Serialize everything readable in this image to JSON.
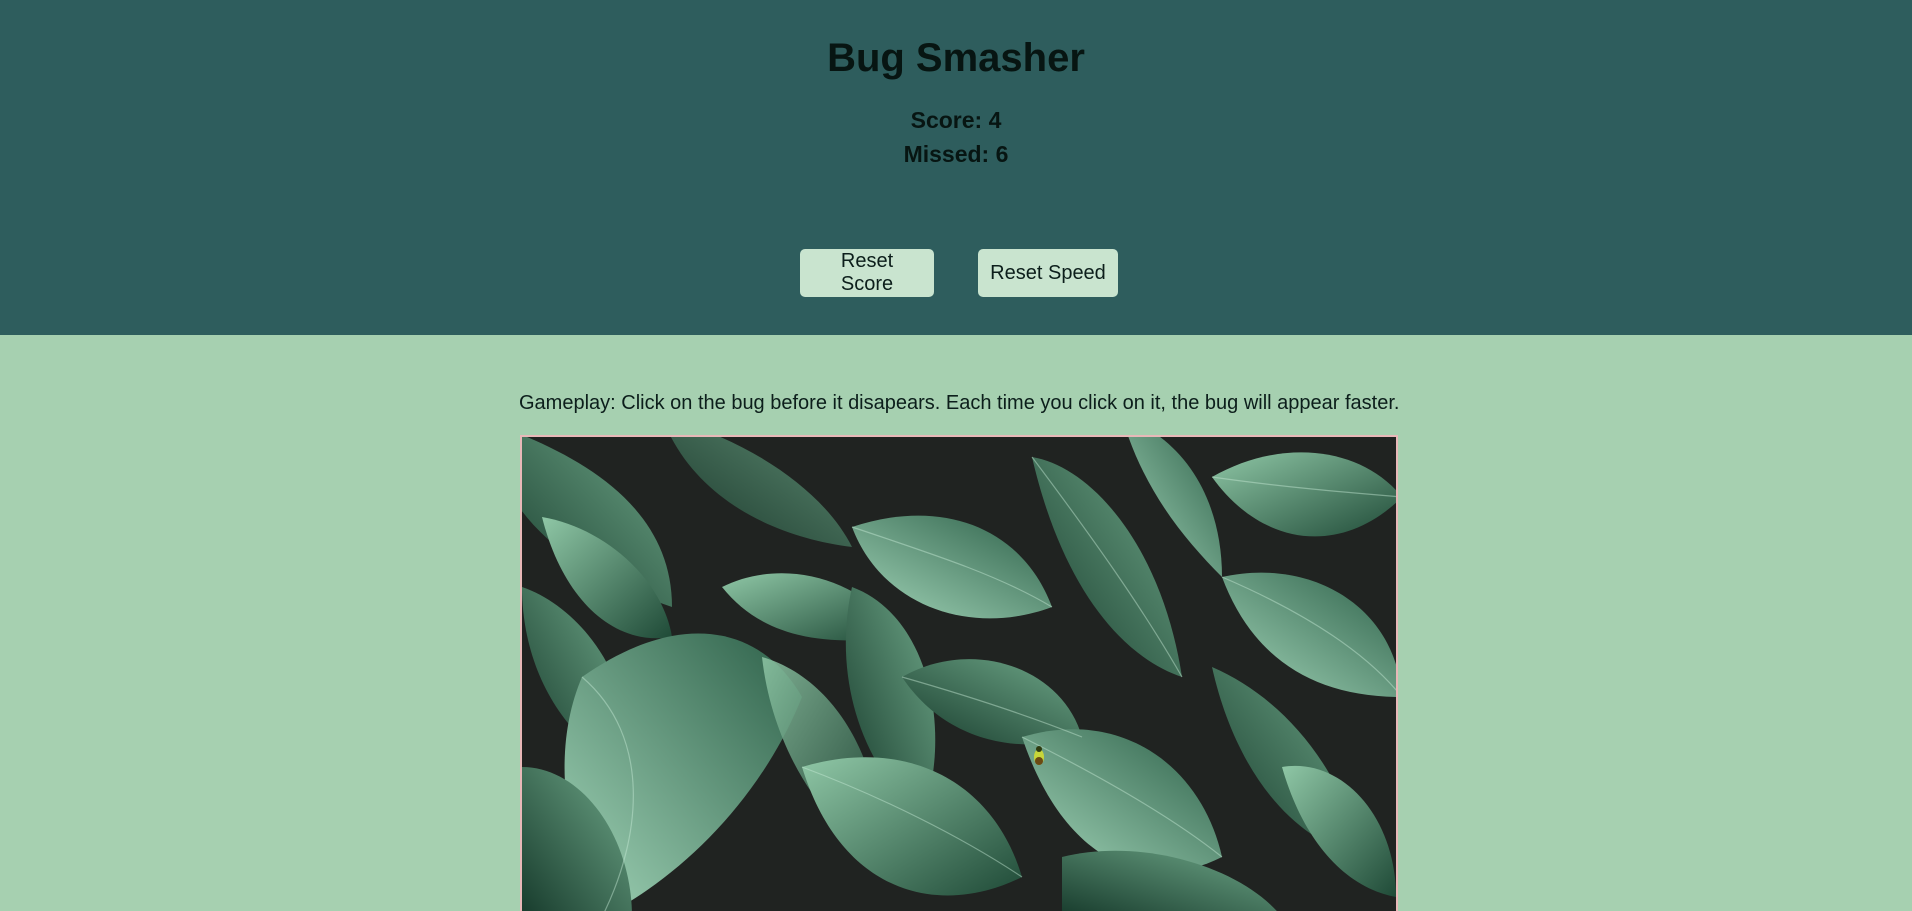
{
  "game": {
    "title": "Bug Smasher",
    "score_text": "Score: 4",
    "missed_text": "Missed: 6",
    "buttons": {
      "reset_score": "Reset Score",
      "reset_speed": "Reset Speed"
    },
    "instructions": "Gameplay: Click on the bug before it disapears. Each time you click on it, the bug will appear faster.",
    "colors": {
      "header_bg": "#2e5d5d",
      "page_bg": "#a6d0b0",
      "button_bg": "#c9e4cf",
      "leaf_dark": "#234a3a",
      "leaf_light": "#7bb597"
    }
  }
}
